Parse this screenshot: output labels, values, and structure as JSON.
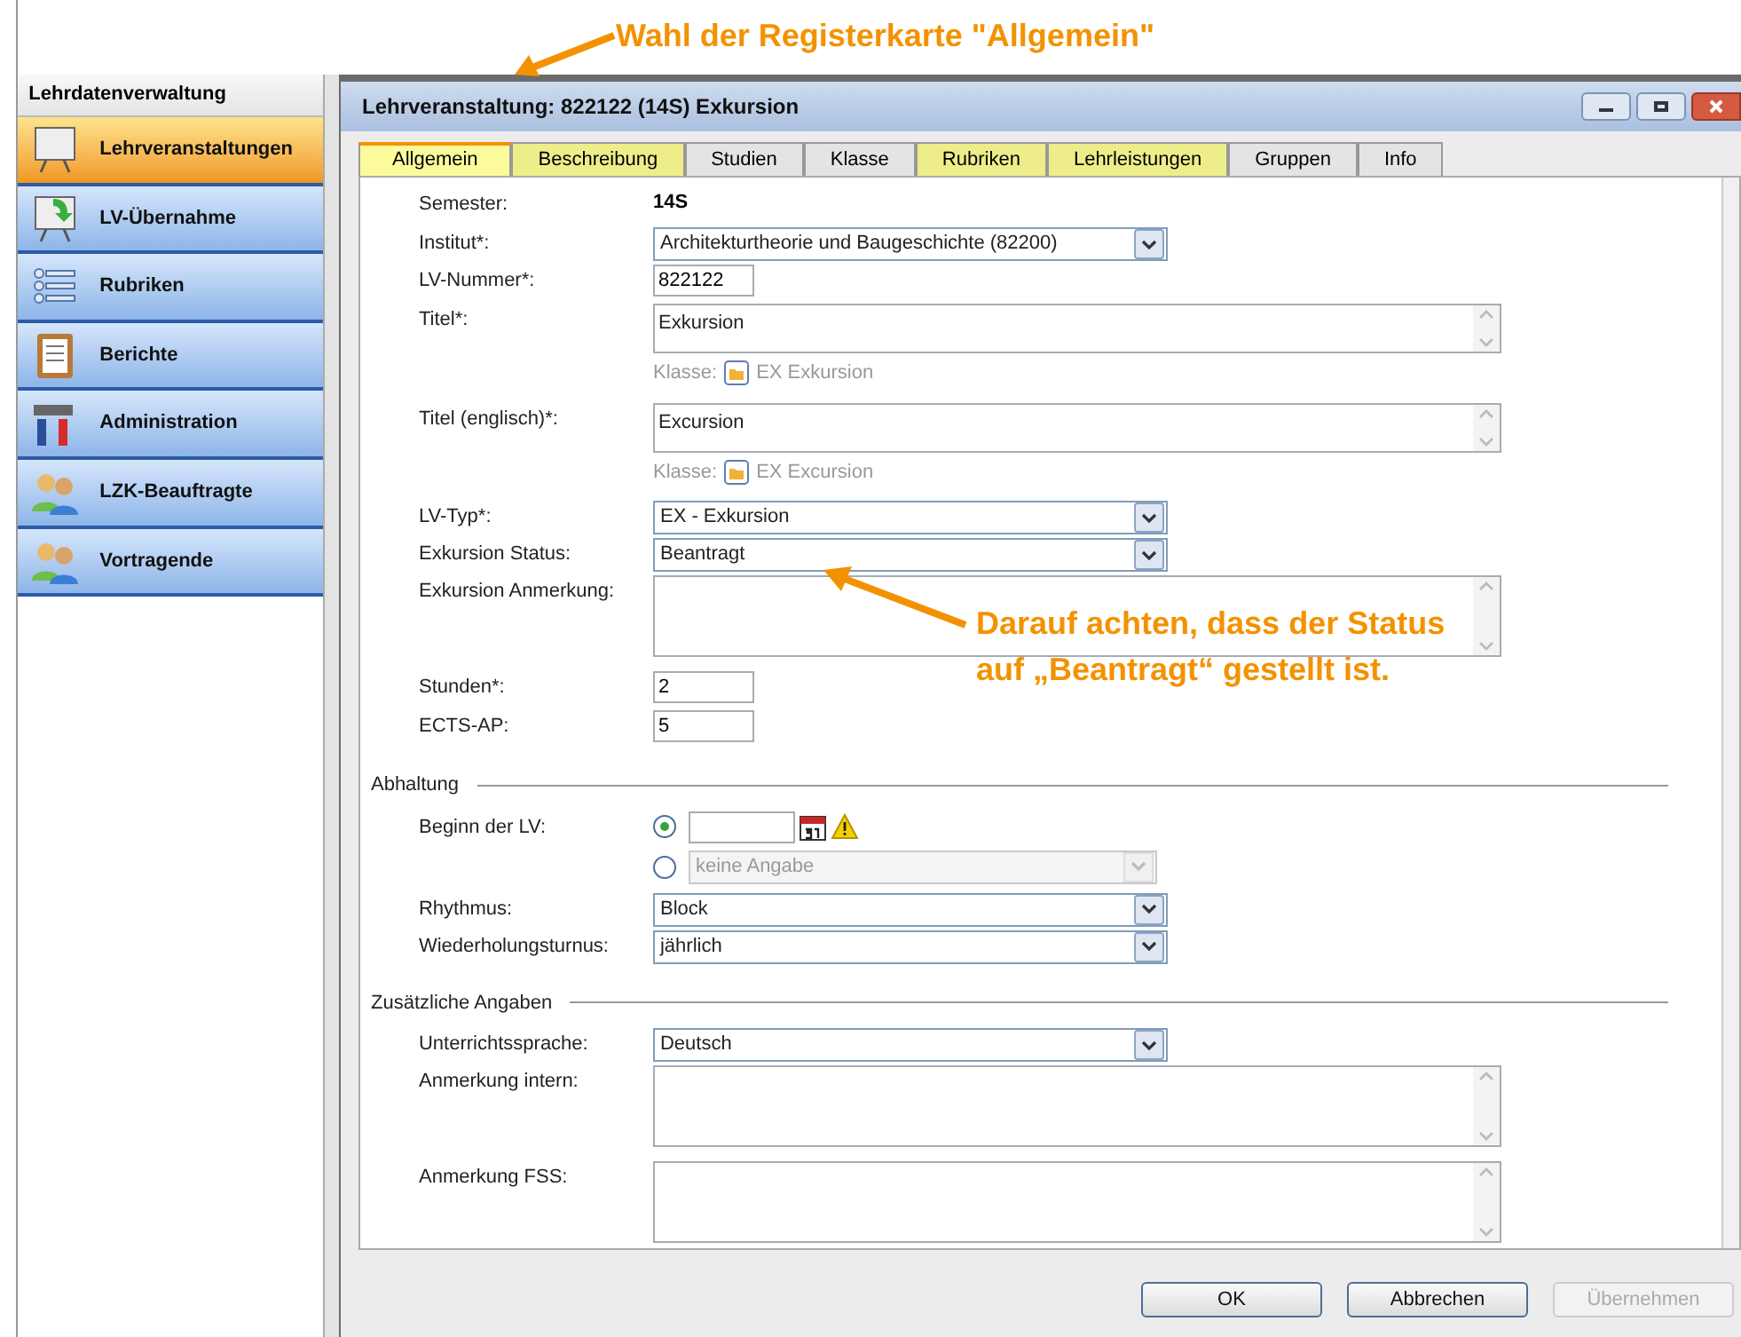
{
  "annotations": {
    "tab_hint": "Wahl der Registerkarte \"Allgemein\"",
    "status_hint": [
      "Darauf achten, dass der Status",
      "auf „Beantragt“ gestellt ist."
    ]
  },
  "sidebar": {
    "title": "Lehrdatenverwaltung",
    "items": [
      {
        "label": "Lehrveranstaltungen",
        "selected": true
      },
      {
        "label": "LV-Übernahme",
        "selected": false
      },
      {
        "label": "Rubriken",
        "selected": false
      },
      {
        "label": "Berichte",
        "selected": false
      },
      {
        "label": "Administration",
        "selected": false
      },
      {
        "label": "LZK-Beauftragte",
        "selected": false
      },
      {
        "label": "Vortragende",
        "selected": false
      }
    ]
  },
  "window": {
    "title": "Lehrveranstaltung: 822122 (14S) Exkursion"
  },
  "tabs": [
    {
      "label": "Allgemein",
      "selected": true,
      "highlighted": true
    },
    {
      "label": "Beschreibung",
      "selected": false,
      "highlighted": true
    },
    {
      "label": "Studien",
      "selected": false,
      "highlighted": false
    },
    {
      "label": "Klasse",
      "selected": false,
      "highlighted": false
    },
    {
      "label": "Rubriken",
      "selected": false,
      "highlighted": true
    },
    {
      "label": "Lehrleistungen",
      "selected": false,
      "highlighted": true
    },
    {
      "label": "Gruppen",
      "selected": false,
      "highlighted": false
    },
    {
      "label": "Info",
      "selected": false,
      "highlighted": false
    }
  ],
  "sections": [
    {
      "rows": [
        {
          "kind": "static",
          "label": "Semester:",
          "value": "14S"
        },
        {
          "kind": "select",
          "label": "Institut*:",
          "value": "Architekturtheorie und Baugeschichte (82200)"
        },
        {
          "kind": "input",
          "label": "LV-Nummer*:",
          "value": "822122"
        },
        {
          "kind": "textarea",
          "label": "Titel*:",
          "value": "Exkursion",
          "klasse": {
            "label": "Klasse:",
            "value": "EX Exkursion"
          }
        },
        {
          "kind": "textarea",
          "label": "Titel (englisch)*:",
          "value": "Excursion",
          "klasse": {
            "label": "Klasse:",
            "value": "EX Excursion"
          }
        },
        {
          "kind": "select",
          "label": "LV-Typ*:",
          "value": "EX - Exkursion"
        },
        {
          "kind": "select",
          "label": "Exkursion Status:",
          "value": "Beantragt"
        },
        {
          "kind": "textarea",
          "label": "Exkursion Anmerkung:"
        },
        {
          "kind": "input",
          "label": "Stunden*:",
          "value": "2"
        },
        {
          "kind": "input",
          "label": "ECTS-AP:",
          "value": "5"
        }
      ]
    },
    {
      "title": "Abhaltung",
      "rows": [
        {
          "kind": "choice",
          "label": "Beginn der LV:",
          "options": [
            {
              "kind": "date",
              "selected": true
            },
            {
              "kind": "select",
              "selected": false,
              "value": "keine Angabe"
            }
          ]
        },
        {
          "kind": "select",
          "label": "Rhythmus:",
          "value": "Block"
        },
        {
          "kind": "select",
          "label": "Wiederholungsturnus:",
          "value": "jährlich"
        }
      ]
    },
    {
      "title": "Zusätzliche Angaben",
      "rows": [
        {
          "kind": "select",
          "label": "Unterrichtssprache:",
          "value": "Deutsch"
        },
        {
          "kind": "textarea",
          "label": "Anmerkung intern:"
        },
        {
          "kind": "textarea",
          "label": "Anmerkung FSS:"
        }
      ]
    }
  ],
  "buttons": [
    {
      "label": "OK",
      "disabled": false
    },
    {
      "label": "Abbrechen",
      "disabled": false
    },
    {
      "label": "Übernehmen",
      "disabled": true
    }
  ]
}
